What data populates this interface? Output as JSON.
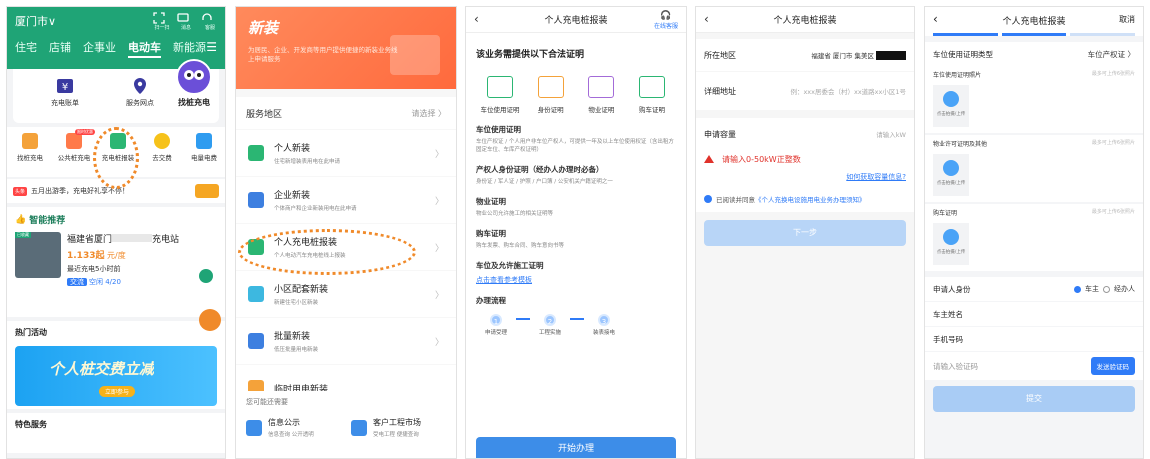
{
  "colors": {
    "green": "#1fa476",
    "orange": "#ff7a4a",
    "blue": "#2f7bf7",
    "red": "#e0322b",
    "ring": "#f08a2a"
  },
  "p1": {
    "city": "厦门市∨",
    "top_icons": [
      "扫一扫",
      "消息",
      "客服"
    ],
    "tabs": [
      "住宅",
      "店铺",
      "企事业",
      "电动车",
      "新能源"
    ],
    "active_tab": "电动车",
    "quick": [
      "充电账单",
      "服务网点",
      "找桩充电"
    ],
    "grid": [
      "找桩充电",
      "公共桩充电",
      "充电桩报装",
      "去交费",
      "电量电费"
    ],
    "grid_badge": "限时优惠",
    "notice_tag": "头条",
    "notice": "五月出游季，充电好礼享不停！",
    "rec_title": "智能推荐",
    "station_tag": "已收藏",
    "station_name": "福建省厦门",
    "station_suffix": "充电站",
    "price_value": "1.133起",
    "price_unit": "元/度",
    "recent": "最近充电5小时前",
    "ac_key": "交流",
    "ac_val": "空闲 4/20",
    "act_title": "热门活动",
    "banner_text": "个人桩交费立减",
    "banner_btn": "立即参与",
    "feat_title": "特色服务"
  },
  "p2": {
    "hero_title": "新装",
    "hero_sub": "为居民、企业、开发商等用户提供便捷的新装业务线上申请服务",
    "region_label": "服务地区",
    "region_select": "请选择 〉",
    "items": [
      {
        "title": "个人新装",
        "sub": "住宅新增装表用电在此申请"
      },
      {
        "title": "企业新装",
        "sub": "个体商户和企业新装用电在此申请"
      },
      {
        "title": "个人充电桩报装",
        "sub": "个人电动汽车充电桩线上报装"
      },
      {
        "title": "小区配套新装",
        "sub": "新建住宅小区新装"
      },
      {
        "title": "批量新装",
        "sub": "低压批量用电新装"
      },
      {
        "title": "临时用电新装",
        "sub": ""
      }
    ],
    "more_title": "您可能还需要",
    "more": [
      {
        "title": "信息公示",
        "sub": "信息查询 公开透明"
      },
      {
        "title": "客户工程市场",
        "sub": "受电工程 便捷查询"
      }
    ]
  },
  "p3": {
    "title": "个人充电桩报装",
    "service": "在线客服",
    "intro": "该业务需提供以下合法证明",
    "docs": [
      "车位使用证明",
      "身份证明",
      "物业证明",
      "购车证明"
    ],
    "sections": [
      {
        "t": "车位使用证明",
        "d": "车位产权证 / 个人用户非车位产权人，可提供一年及以上车位使用权证（含出租方固定车位、车库产权证明）"
      },
      {
        "t": "产权人身份证明（经办人办理时必备）",
        "d": "身份证 / 军人证 / 护照 / 户口簿 / 公安机关户籍证明之一"
      },
      {
        "t": "物业证明",
        "d": "物业公司允许施工的相关证明等"
      },
      {
        "t": "购车证明",
        "d": "购车发票、购车合同、购车意向书等"
      },
      {
        "t": "车位及允许施工证明",
        "d": ""
      }
    ],
    "ref_link": "点击查看参考模板",
    "flow_title": "办理流程",
    "steps": [
      "申请受理",
      "工程实施",
      "装表接电"
    ],
    "start": "开始办理"
  },
  "p4": {
    "title": "个人充电桩报装",
    "area_label": "所在地区",
    "area_value": "福建省 厦门市 集美区",
    "addr_label": "详细地址",
    "addr_ph": "例：xxx居委会（村）xx道路xx小区1号",
    "cap_label": "申请容量",
    "cap_ph": "请输入kW",
    "warn": "请输入0-50kW正整数",
    "how": "如何获取容量信息?",
    "agree_pre": "已阅读并同意",
    "agree_link": "《个人充换电设施用电业务办理须知》",
    "next": "下一步"
  },
  "p5": {
    "title": "个人充电桩报装",
    "cancel": "取消",
    "type_label": "车位使用证明类型",
    "type_value": "车位产权证 〉",
    "uploads": [
      {
        "t": "车位使用证明照片",
        "n": "最多可上传6张照片"
      },
      {
        "t": "物业许可证明及其他",
        "n": "最多可上传6张照片"
      },
      {
        "t": "购车证明",
        "n": "最多可上传6张照片"
      }
    ],
    "upload_btn": "点击拍摄/上传",
    "identity_label": "申请人身份",
    "opt_owner": "车主",
    "opt_agent": "经办人",
    "owner_name": "车主姓名",
    "phone": "手机号码",
    "code_ph": "请输入验证码",
    "send": "发送验证码",
    "submit": "提交"
  }
}
